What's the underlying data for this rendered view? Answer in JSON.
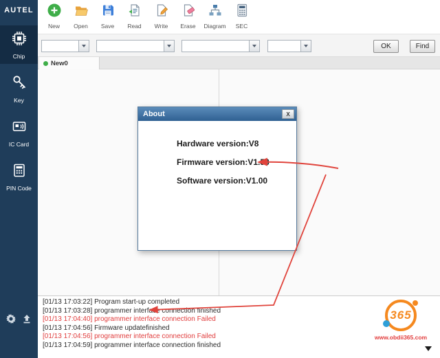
{
  "app": {
    "brand": "AUTEL"
  },
  "sidebar": {
    "items": [
      {
        "label": "Chip",
        "icon": "chip-icon",
        "active": true
      },
      {
        "label": "Key",
        "icon": "key-icon",
        "active": false
      },
      {
        "label": "IC Card",
        "icon": "ic-card-icon",
        "active": false
      },
      {
        "label": "PIN Code",
        "icon": "pin-code-icon",
        "active": false
      }
    ],
    "bottom_icons": [
      "gear-icon",
      "upload-arrow-icon"
    ]
  },
  "toolbar": {
    "items": [
      {
        "label": "New",
        "icon": "new-icon"
      },
      {
        "label": "Open",
        "icon": "open-folder-icon"
      },
      {
        "label": "Save",
        "icon": "save-icon"
      },
      {
        "label": "Read",
        "icon": "read-icon"
      },
      {
        "label": "Write",
        "icon": "write-icon"
      },
      {
        "label": "Erase",
        "icon": "erase-icon"
      },
      {
        "label": "Diagram",
        "icon": "diagram-icon"
      },
      {
        "label": "SEC",
        "icon": "sec-icon"
      }
    ]
  },
  "filterbar": {
    "dropdowns": [
      {
        "value": ""
      },
      {
        "value": ""
      },
      {
        "value": ""
      },
      {
        "value": ""
      }
    ],
    "ok_label": "OK",
    "find_label": "Find"
  },
  "tabs": [
    {
      "label": "New0",
      "active": true
    }
  ],
  "dialog": {
    "title": "About",
    "close_label": "X",
    "lines": [
      "Hardware version:V8",
      "Firmware version:V1.53",
      "Software version:V1.00"
    ]
  },
  "log": {
    "entries": [
      {
        "text": "[01/13 17:03:22] Program start-up completed",
        "status": "ok"
      },
      {
        "text": "[01/13 17:03:28] programmer interface connection finished",
        "status": "ok"
      },
      {
        "text": "[01/13 17:04:40] programmer interface connection Failed",
        "status": "failed"
      },
      {
        "text": "[01/13 17:04:56] Firmware updatefinished",
        "status": "ok"
      },
      {
        "text": "[01/13 17:04:56] programmer interface connection Failed",
        "status": "failed"
      },
      {
        "text": "[01/13 17:04:59] programmer interface connection finished",
        "status": "ok"
      }
    ]
  },
  "branding": {
    "logo_text": "365",
    "url": "www.obdii365.com"
  },
  "colors": {
    "sidebar": "#1f3d5a",
    "sidebar_active": "#142c44",
    "dialog_titlebar": "#3a6ea5",
    "log_error": "#e03c3c",
    "annotation_arrow": "#e0433b",
    "accent_green": "#3fae49",
    "logo_orange": "#f5891f"
  }
}
